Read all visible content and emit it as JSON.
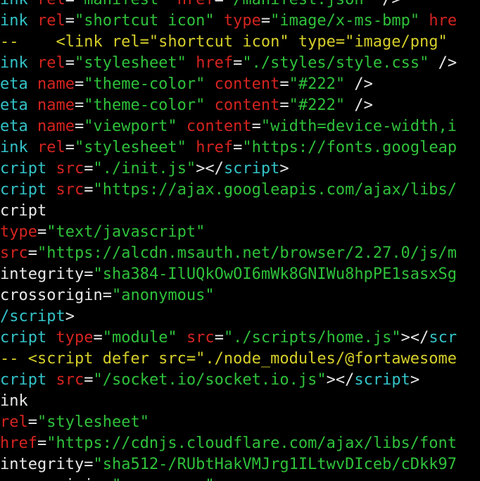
{
  "colors": {
    "tag": "#33c3c8",
    "attr": "#d4241f",
    "string": "#2fc13b",
    "punct": "#e8e8e8",
    "comment": "#d6cf2a",
    "plain": "#e8e8e8"
  },
  "lines": [
    [
      [
        "tag",
        "ink "
      ],
      [
        "attr",
        "rel"
      ],
      [
        "punct",
        "="
      ],
      [
        "string",
        "\"manifest\""
      ],
      [
        "punct",
        " "
      ],
      [
        "attr",
        "href"
      ],
      [
        "punct",
        "="
      ],
      [
        "string",
        "\"/manifest.json\""
      ],
      [
        "punct",
        " />"
      ]
    ],
    [
      [
        "tag",
        "ink "
      ],
      [
        "attr",
        "rel"
      ],
      [
        "punct",
        "="
      ],
      [
        "string",
        "\"shortcut icon\""
      ],
      [
        "punct",
        " "
      ],
      [
        "attr",
        "type"
      ],
      [
        "punct",
        "="
      ],
      [
        "string",
        "\"image/x-ms-bmp\""
      ],
      [
        "punct",
        " "
      ],
      [
        "attr",
        "hre"
      ]
    ],
    [
      [
        "comment",
        "--    <link rel=\"shortcut icon\" type=\"image/png\""
      ]
    ],
    [
      [
        "tag",
        "ink "
      ],
      [
        "attr",
        "rel"
      ],
      [
        "punct",
        "="
      ],
      [
        "string",
        "\"stylesheet\""
      ],
      [
        "punct",
        " "
      ],
      [
        "attr",
        "href"
      ],
      [
        "punct",
        "="
      ],
      [
        "string",
        "\"./styles/style.css\""
      ],
      [
        "punct",
        " />"
      ]
    ],
    [
      [
        "tag",
        "eta "
      ],
      [
        "attr",
        "name"
      ],
      [
        "punct",
        "="
      ],
      [
        "string",
        "\"theme-color\""
      ],
      [
        "punct",
        " "
      ],
      [
        "attr",
        "content"
      ],
      [
        "punct",
        "="
      ],
      [
        "string",
        "\"#222\""
      ],
      [
        "punct",
        " />"
      ]
    ],
    [
      [
        "tag",
        "eta "
      ],
      [
        "attr",
        "name"
      ],
      [
        "punct",
        "="
      ],
      [
        "string",
        "\"theme-color\""
      ],
      [
        "punct",
        " "
      ],
      [
        "attr",
        "content"
      ],
      [
        "punct",
        "="
      ],
      [
        "string",
        "\"#222\""
      ],
      [
        "punct",
        " />"
      ]
    ],
    [
      [
        "tag",
        "eta "
      ],
      [
        "attr",
        "name"
      ],
      [
        "punct",
        "="
      ],
      [
        "string",
        "\"viewport\""
      ],
      [
        "punct",
        " "
      ],
      [
        "attr",
        "content"
      ],
      [
        "punct",
        "="
      ],
      [
        "string",
        "\"width=device-width,i"
      ]
    ],
    [
      [
        "tag",
        "ink "
      ],
      [
        "attr",
        "rel"
      ],
      [
        "punct",
        "="
      ],
      [
        "string",
        "\"stylesheet\""
      ],
      [
        "punct",
        " "
      ],
      [
        "attr",
        "href"
      ],
      [
        "punct",
        "="
      ],
      [
        "string",
        "\"https://fonts.googleap"
      ]
    ],
    [
      [
        "tag",
        "cript "
      ],
      [
        "attr",
        "src"
      ],
      [
        "punct",
        "="
      ],
      [
        "string",
        "\"./init.js\""
      ],
      [
        "punct",
        "></"
      ],
      [
        "tag",
        "script"
      ],
      [
        "punct",
        ">"
      ]
    ],
    [
      [
        "tag",
        "cript "
      ],
      [
        "attr",
        "src"
      ],
      [
        "punct",
        "="
      ],
      [
        "string",
        "\"https://ajax.googleapis.com/ajax/libs/"
      ]
    ],
    [
      [
        "plain",
        "cript"
      ]
    ],
    [
      [
        "attr",
        "type"
      ],
      [
        "punct",
        "="
      ],
      [
        "string",
        "\"text/javascript\""
      ]
    ],
    [
      [
        "attr",
        "src"
      ],
      [
        "punct",
        "="
      ],
      [
        "string",
        "\"https://alcdn.msauth.net/browser/2.27.0/js/m"
      ]
    ],
    [
      [
        "plain",
        "integrity"
      ],
      [
        "punct",
        "="
      ],
      [
        "string",
        "\"sha384-IlUQkOwOI6mWk8GNIWu8hpPE1sasxSg"
      ]
    ],
    [
      [
        "plain",
        "crossorigin"
      ],
      [
        "punct",
        "="
      ],
      [
        "string",
        "\"anonymous\""
      ]
    ],
    [
      [
        "tag",
        "/script"
      ],
      [
        "punct",
        ">"
      ]
    ],
    [
      [
        "tag",
        "cript "
      ],
      [
        "attr",
        "type"
      ],
      [
        "punct",
        "="
      ],
      [
        "string",
        "\"module\""
      ],
      [
        "punct",
        " "
      ],
      [
        "attr",
        "src"
      ],
      [
        "punct",
        "="
      ],
      [
        "string",
        "\"./scripts/home.js\""
      ],
      [
        "punct",
        "></"
      ],
      [
        "tag",
        "scr"
      ]
    ],
    [
      [
        "comment",
        "-- <script defer src=\"./node_modules/@fortawesome"
      ]
    ],
    [
      [
        "tag",
        "cript "
      ],
      [
        "attr",
        "src"
      ],
      [
        "punct",
        "="
      ],
      [
        "string",
        "\"/socket.io/socket.io.js\""
      ],
      [
        "punct",
        "></"
      ],
      [
        "tag",
        "script"
      ],
      [
        "punct",
        ">"
      ]
    ],
    [
      [
        "plain",
        "ink"
      ]
    ],
    [
      [
        "attr",
        "rel"
      ],
      [
        "punct",
        "="
      ],
      [
        "string",
        "\"stylesheet\""
      ]
    ],
    [
      [
        "attr",
        "href"
      ],
      [
        "punct",
        "="
      ],
      [
        "string",
        "\"https://cdnjs.cloudflare.com/ajax/libs/font"
      ]
    ],
    [
      [
        "plain",
        "integrity"
      ],
      [
        "punct",
        "="
      ],
      [
        "string",
        "\"sha512-/RUbtHakVMJrg1ILtwvDIceb/cDkk97"
      ]
    ],
    [
      [
        "plain",
        "crossorigin"
      ],
      [
        "punct",
        "="
      ],
      [
        "string",
        "\"anonymous\""
      ]
    ]
  ]
}
